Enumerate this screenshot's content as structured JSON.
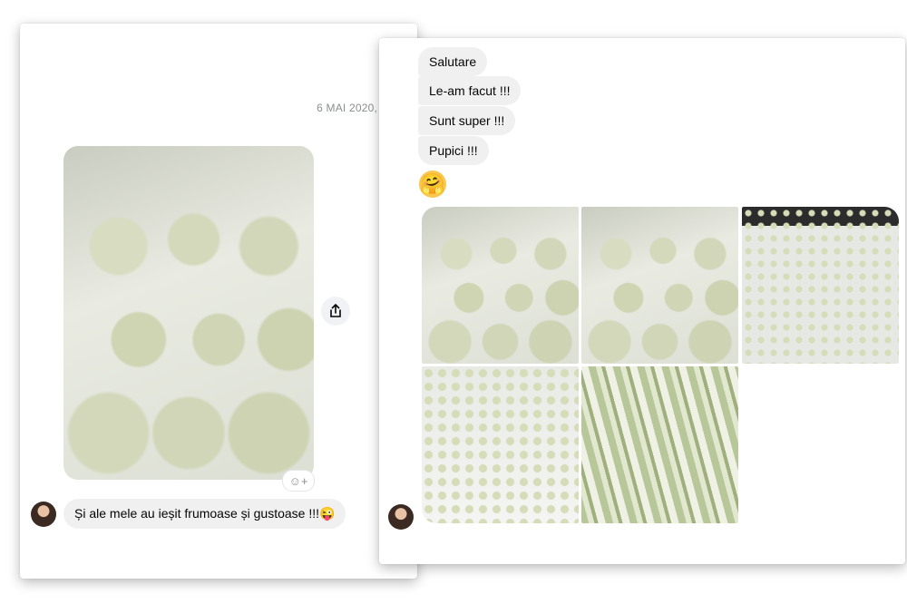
{
  "left_card": {
    "date": "6 MAI 2020,",
    "message": "Și ale mele au ieșit frumoase și gustoase !!!😜",
    "icons": [
      "share-icon",
      "add-reaction-icon"
    ]
  },
  "right_card": {
    "messages": [
      "Salutare",
      "Le-am facut !!!",
      "Sunt super !!!",
      "Pupici !!!"
    ],
    "emoji": "🤗",
    "photo_count": 5
  }
}
